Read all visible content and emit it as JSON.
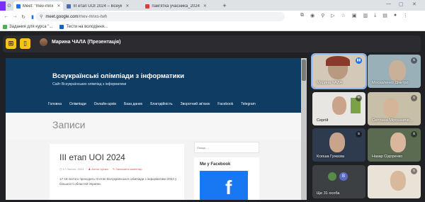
{
  "browser": {
    "tabs": [
      {
        "label": "Meet: \"mev-mnx",
        "active": true,
        "color": "#1a73e8"
      },
      {
        "label": "III етап UOI 2024 – Всеук",
        "active": false,
        "color": "#4a6cb3"
      },
      {
        "label": "пам'ятка учасника_2024",
        "active": false,
        "color": "#e53935"
      }
    ],
    "new_tab": "+",
    "url_host": "meet.google.com",
    "url_path": "/mev-mnxs-twh",
    "bookmarks": [
      {
        "label": "Задания для курса \"..."
      },
      {
        "label": "Тести на володіння..."
      }
    ]
  },
  "meet": {
    "presenter_label": "Марина ЧАЛА (Презентація)",
    "accent": "#f5c31a"
  },
  "shared_site": {
    "title": "Всеукраїнські олімпіади з інформатики",
    "subtitle": "Сайт Всеукраїнських олімпіад з інформатики",
    "nav": [
      "Головна",
      "Олімпіади",
      "Онлайн-архів",
      "База даних",
      "Благодійність",
      "Зворотний зв'язок",
      "Facebook",
      "Telegram"
    ],
    "page_heading": "Записи",
    "post_title": "III етап UOI 2024",
    "post_date": "17 Лютого, 2024",
    "post_author": "Антон Цапко",
    "post_comments": "Залишити коментар",
    "post_text": "17-18 лютого проходить III етап Всеукраїнської олімпіади з інформатики 2024 у більшості областей України.",
    "search_placeholder": "Пошук ...",
    "fb_heading": "Ми у Facebook",
    "header_color": "#0f3c63"
  },
  "participants": [
    {
      "name": "Марина ЧАЛА",
      "mic": "on"
    },
    {
      "name": "Москаленко Дмитро",
      "mic": "off"
    },
    {
      "name": "Сергій",
      "mic": "off"
    },
    {
      "name": "Світлана Мірошниче...",
      "mic": "off"
    },
    {
      "name": "Ксюша Гунєєва",
      "mic": "off"
    },
    {
      "name": "Назар Сідоренко",
      "mic": "off"
    },
    {
      "name": "Ще 31 особа",
      "mic": "",
      "avatar_letter": "В"
    },
    {
      "name": "",
      "mic": "off"
    }
  ]
}
